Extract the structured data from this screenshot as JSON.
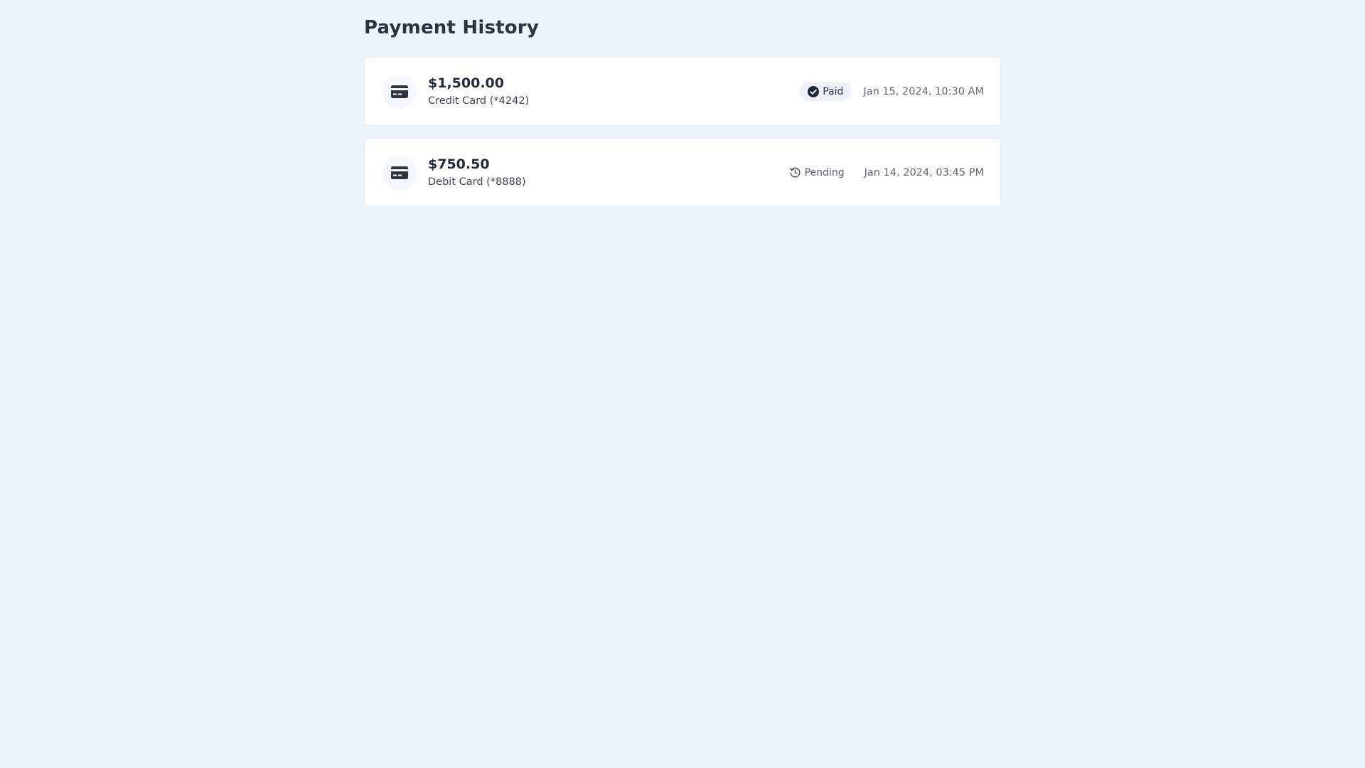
{
  "page": {
    "title": "Payment History"
  },
  "payments": [
    {
      "icon": "credit-card-icon",
      "amount": "$1,500.00",
      "method": "Credit Card (*4242)",
      "status": "Paid",
      "status_icon": "check-circle-icon",
      "date": "Jan 15, 2024, 10:30 AM"
    },
    {
      "icon": "credit-card-icon",
      "amount": "$750.50",
      "method": "Debit Card (*8888)",
      "status": "Pending",
      "status_icon": "history-icon",
      "date": "Jan 14, 2024, 03:45 PM"
    }
  ],
  "colors": {
    "background": "#eef3fe",
    "card": "#ffffff",
    "text_primary": "#222c38",
    "text_secondary": "#5d6672",
    "badge_paid_bg": "#eef2f8"
  }
}
